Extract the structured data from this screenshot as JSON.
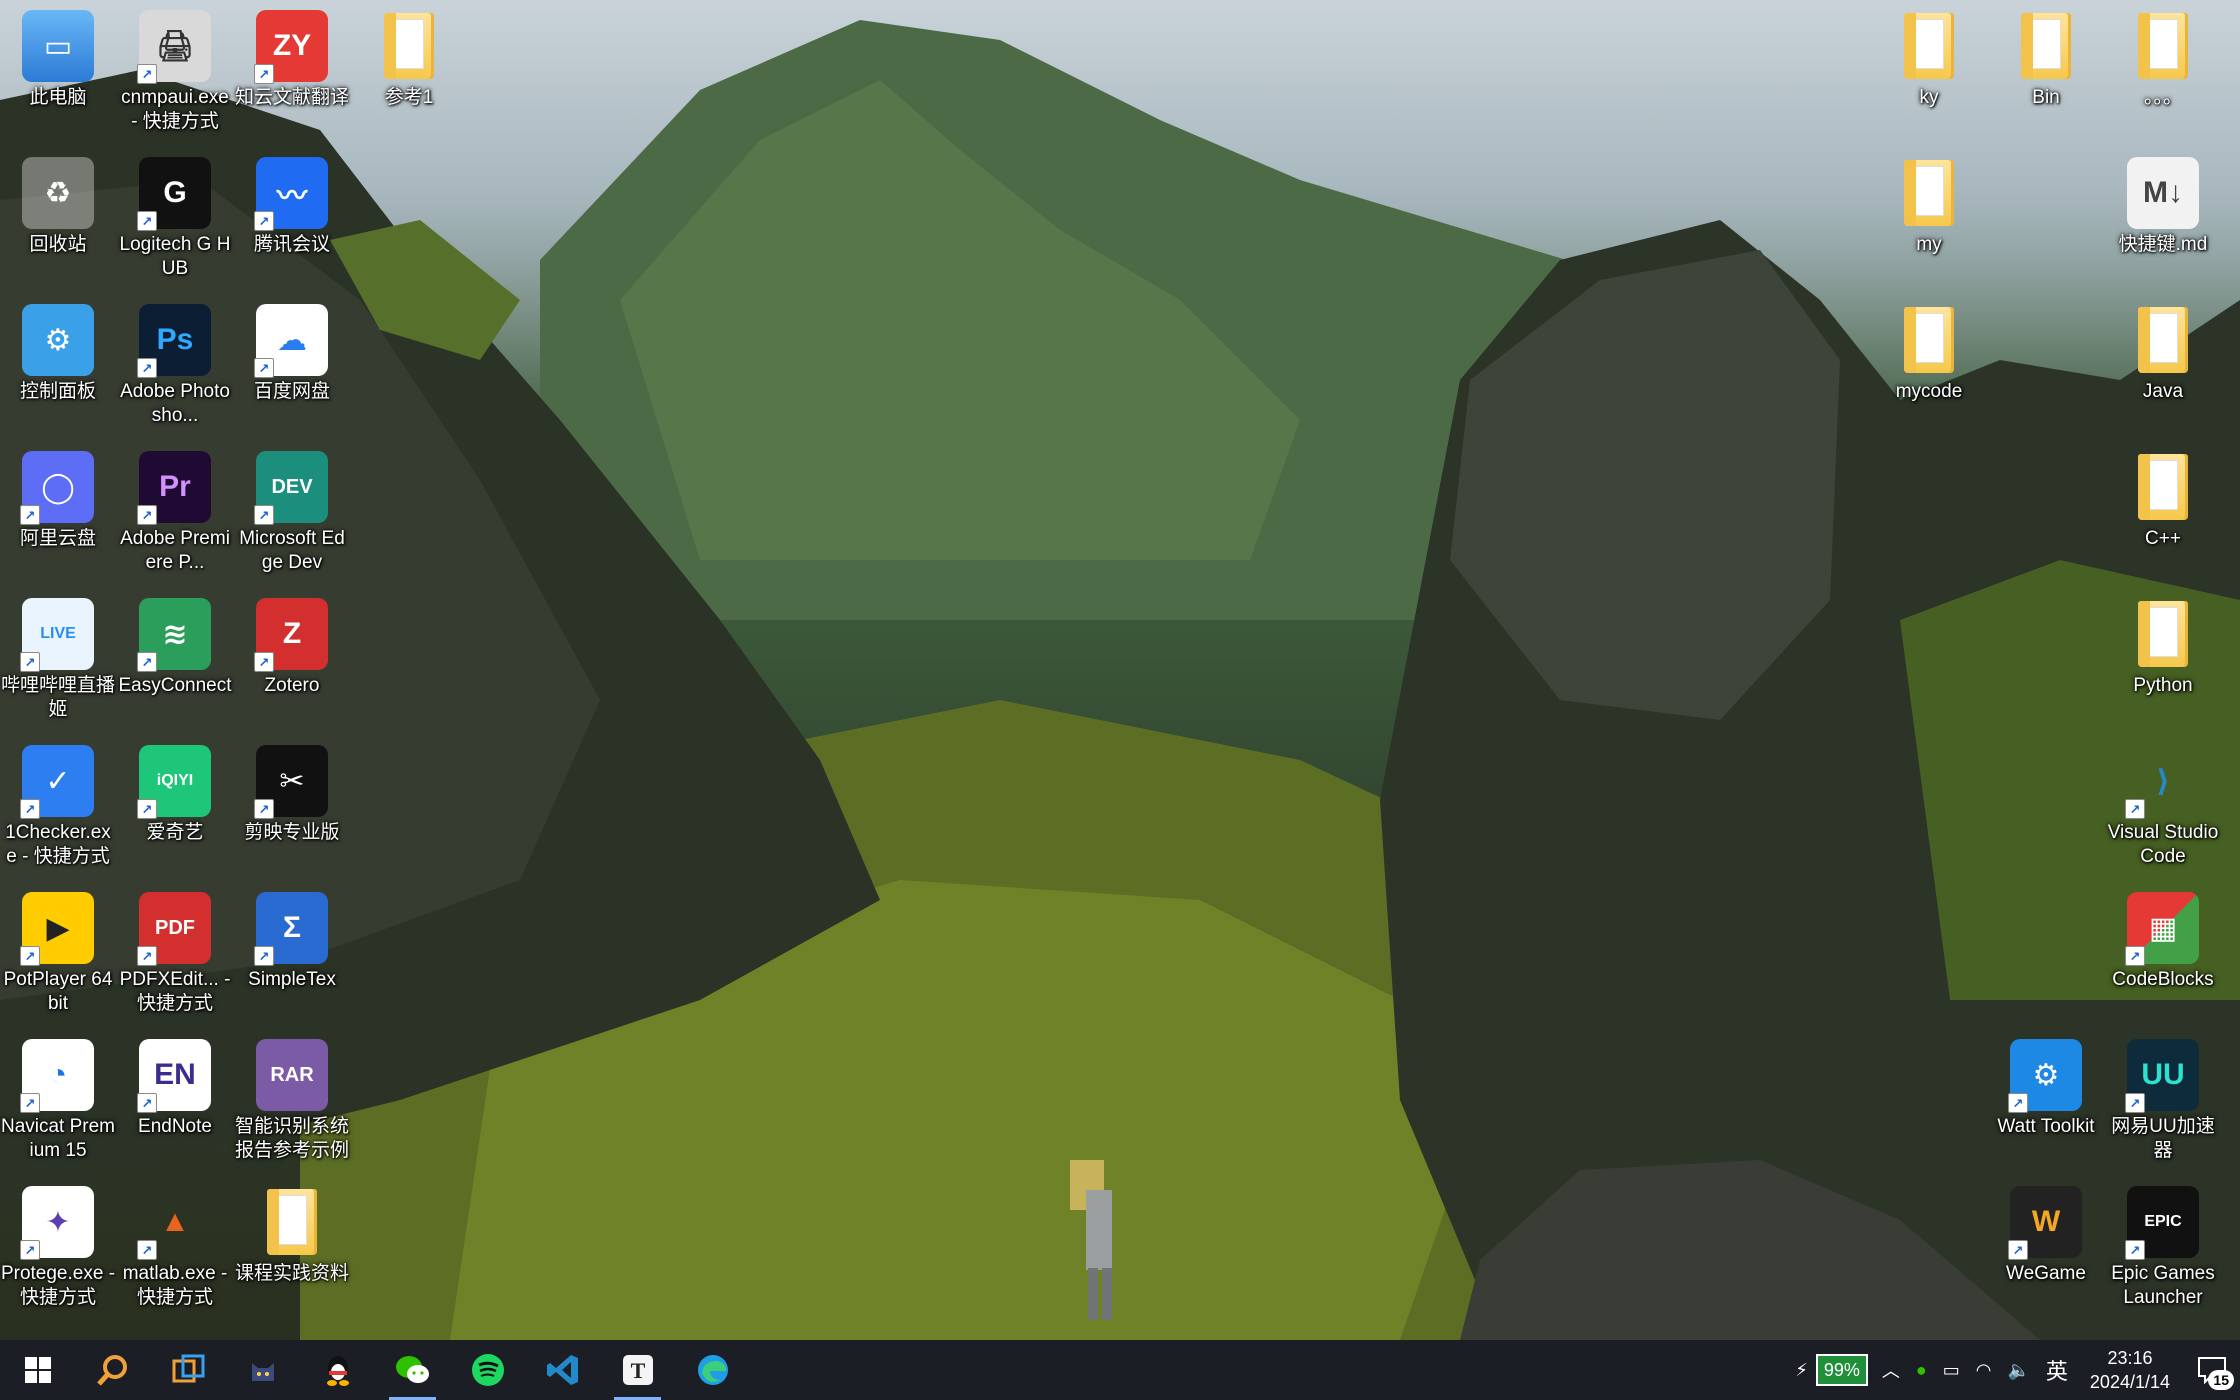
{
  "desktop": {
    "left_icons": [
      {
        "label": "此电脑",
        "icon": "computer-icon"
      },
      {
        "label": "cnmpaui.exe - 快捷方式",
        "icon": "printer-icon"
      },
      {
        "label": "知云文献翻译",
        "icon": "zy-icon"
      },
      {
        "label": "参考1",
        "icon": "folder-icon"
      },
      {
        "label": "回收站",
        "icon": "recycle-bin-icon"
      },
      {
        "label": "Logitech G HUB",
        "icon": "logitech-icon"
      },
      {
        "label": "腾讯会议",
        "icon": "tencent-meeting-icon"
      },
      {
        "label": "控制面板",
        "icon": "control-panel-icon"
      },
      {
        "label": "Adobe Photosho...",
        "icon": "photoshop-icon"
      },
      {
        "label": "百度网盘",
        "icon": "baidu-netdisk-icon"
      },
      {
        "label": "阿里云盘",
        "icon": "aliyun-drive-icon"
      },
      {
        "label": "Adobe Premiere P...",
        "icon": "premiere-icon"
      },
      {
        "label": "Microsoft Edge Dev",
        "icon": "edge-dev-icon"
      },
      {
        "label": "哔哩哔哩直播姬",
        "icon": "bilibili-live-icon"
      },
      {
        "label": "EasyConnect",
        "icon": "easyconnect-icon"
      },
      {
        "label": "Zotero",
        "icon": "zotero-icon"
      },
      {
        "label": "1Checker.exe - 快捷方式",
        "icon": "1checker-icon"
      },
      {
        "label": "爱奇艺",
        "icon": "iqiyi-icon"
      },
      {
        "label": "剪映专业版",
        "icon": "capcut-icon"
      },
      {
        "label": "PotPlayer 64 bit",
        "icon": "potplayer-icon"
      },
      {
        "label": "PDFXEdit... - 快捷方式",
        "icon": "pdfxedit-icon"
      },
      {
        "label": "SimpleTex",
        "icon": "simpletex-icon"
      },
      {
        "label": "Navicat Premium 15",
        "icon": "navicat-icon"
      },
      {
        "label": "EndNote",
        "icon": "endnote-icon"
      },
      {
        "label": "智能识别系统报告参考示例",
        "icon": "rar-archive-icon"
      },
      {
        "label": "Protege.exe - 快捷方式",
        "icon": "protege-icon"
      },
      {
        "label": "matlab.exe - 快捷方式",
        "icon": "matlab-icon"
      },
      {
        "label": "课程实践资料",
        "icon": "folder-icon"
      }
    ],
    "right_icons": [
      {
        "label": "ky",
        "icon": "folder-icon"
      },
      {
        "label": "Bin",
        "icon": "folder-icon"
      },
      {
        "label": "。。。",
        "icon": "folder-icon"
      },
      {
        "label": "my",
        "icon": "folder-icon"
      },
      {
        "label": "快捷键.md",
        "icon": "markdown-file-icon"
      },
      {
        "label": "mycode",
        "icon": "folder-icon"
      },
      {
        "label": "Java",
        "icon": "folder-icon"
      },
      {
        "label": "C++",
        "icon": "folder-icon"
      },
      {
        "label": "Python",
        "icon": "folder-icon"
      },
      {
        "label": "Visual Studio Code",
        "icon": "vscode-icon"
      },
      {
        "label": "CodeBlocks",
        "icon": "codeblocks-icon"
      },
      {
        "label": "Watt Toolkit",
        "icon": "watt-toolkit-icon"
      },
      {
        "label": "网易UU加速器",
        "icon": "uu-accelerator-icon"
      },
      {
        "label": "WeGame",
        "icon": "wegame-icon"
      },
      {
        "label": "Epic Games Launcher",
        "icon": "epic-games-icon"
      }
    ]
  },
  "taskbar": {
    "apps": [
      {
        "name": "start-button",
        "icon": "windows-logo-icon"
      },
      {
        "name": "search-button",
        "icon": "search-icon"
      },
      {
        "name": "task-view-button",
        "icon": "task-view-icon"
      },
      {
        "name": "taskbar-app-cat",
        "icon": "cat-icon"
      },
      {
        "name": "taskbar-app-qq",
        "icon": "qq-icon"
      },
      {
        "name": "taskbar-app-wechat",
        "icon": "wechat-icon"
      },
      {
        "name": "taskbar-app-spotify",
        "icon": "spotify-icon"
      },
      {
        "name": "taskbar-app-vscode",
        "icon": "vscode-icon"
      },
      {
        "name": "taskbar-app-typora",
        "icon": "typora-icon"
      },
      {
        "name": "taskbar-app-edge",
        "icon": "edge-icon"
      }
    ],
    "tray": {
      "battery_percent": "99%",
      "ime_label": "英",
      "time": "23:16",
      "date": "2024/1/14",
      "notification_count": "15"
    }
  }
}
